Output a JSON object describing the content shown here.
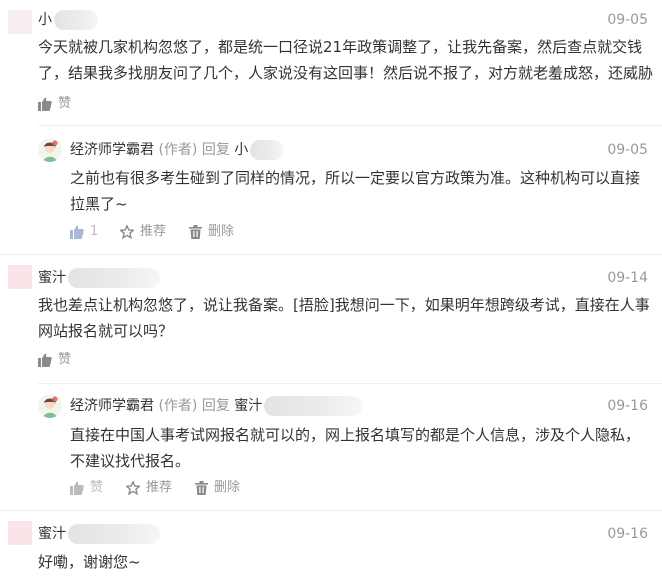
{
  "comments": [
    {
      "user": "小",
      "date": "09-05",
      "lines": [
        "今天就被几家机构忽悠了，都是统一口径说21年政策调整了，让我先备案，然后查点就交钱",
        "了，结果我多找朋友问了几个，人家说没有这回事！然后说不报了，对方就老羞成怒，还威胁"
      ],
      "like_label": "赞",
      "reply": {
        "author": "经济师学霸君",
        "author_tag": "(作者)",
        "reply_word": "回复",
        "reply_to": "小",
        "date": "09-05",
        "lines": [
          "之前也有很多考生碰到了同样的情况，所以一定要以官方政策为准。这种机构可以直接",
          "拉黑了~"
        ],
        "like_count": "1",
        "recommend_label": "推荐",
        "delete_label": "删除"
      }
    },
    {
      "user": "蜜汁",
      "date": "09-14",
      "lines": [
        "我也差点让机构忽悠了，说让我备案。[捂脸]我想问一下，如果明年想跨级考试，直接在人事",
        "网站报名就可以吗？"
      ],
      "like_label": "赞",
      "reply": {
        "author": "经济师学霸君",
        "author_tag": "(作者)",
        "reply_word": "回复",
        "reply_to": "蜜汁",
        "date": "09-16",
        "lines": [
          "直接在中国人事考试网报名就可以的，网上报名填写的都是个人信息，涉及个人隐私，",
          "不建议找代报名。"
        ],
        "like_label": "赞",
        "recommend_label": "推荐",
        "delete_label": "删除"
      }
    },
    {
      "user": "蜜汁",
      "date": "09-16",
      "lines": [
        "好嘞，谢谢您~"
      ]
    }
  ],
  "colors": {
    "avatar_pink": "#fbe3e8",
    "text": "#333333",
    "muted": "#999999"
  },
  "icons": [
    "thumbs-up-icon",
    "star-icon",
    "trash-icon",
    "author-avatar-icon"
  ]
}
